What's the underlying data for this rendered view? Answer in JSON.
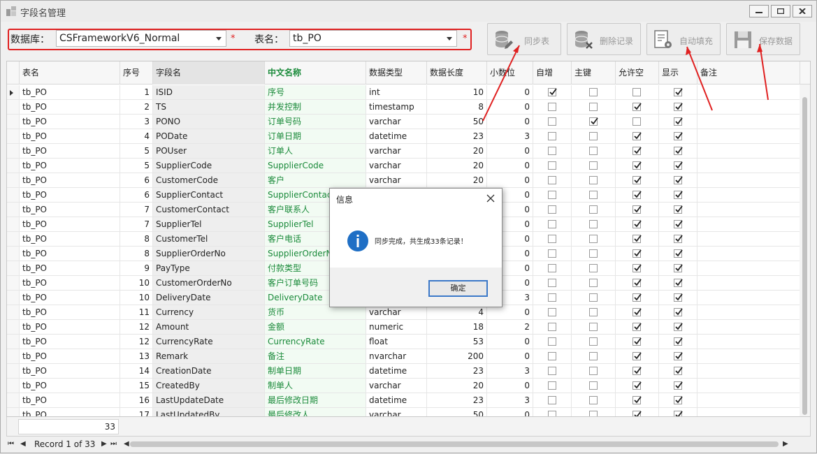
{
  "window": {
    "title": "字段名管理"
  },
  "toolbar": {
    "db_label": "数据库：",
    "db_value": "CSFrameworkV6_Normal",
    "table_label": "表名：",
    "table_value": "tb_PO",
    "required_mark": "*",
    "buttons": [
      {
        "label": "同步表",
        "icon": "database-sync-icon"
      },
      {
        "label": "删除记录",
        "icon": "database-delete-icon"
      },
      {
        "label": "自动填充",
        "icon": "document-gear-icon"
      },
      {
        "label": "保存数据",
        "icon": "floppy-disk-icon"
      }
    ]
  },
  "grid": {
    "columns": [
      "表名",
      "序号",
      "字段名",
      "中文名称",
      "数据类型",
      "数据长度",
      "小数位",
      "自增",
      "主键",
      "允许空",
      "显示",
      "备注"
    ],
    "rows": [
      {
        "table": "tb_PO",
        "seq": "1",
        "field": "ISID",
        "cn": "序号",
        "type": "int",
        "len": "10",
        "dec": "0",
        "auto": true,
        "pk": false,
        "nul": false,
        "show": true
      },
      {
        "table": "tb_PO",
        "seq": "2",
        "field": "TS",
        "cn": "并发控制",
        "type": "timestamp",
        "len": "8",
        "dec": "0",
        "auto": false,
        "pk": false,
        "nul": true,
        "show": true
      },
      {
        "table": "tb_PO",
        "seq": "3",
        "field": "PONO",
        "cn": "订单号码",
        "type": "varchar",
        "len": "50",
        "dec": "0",
        "auto": false,
        "pk": true,
        "nul": false,
        "show": true
      },
      {
        "table": "tb_PO",
        "seq": "4",
        "field": "PODate",
        "cn": "订单日期",
        "type": "datetime",
        "len": "23",
        "dec": "3",
        "auto": false,
        "pk": false,
        "nul": true,
        "show": true
      },
      {
        "table": "tb_PO",
        "seq": "5",
        "field": "POUser",
        "cn": "订单人",
        "type": "varchar",
        "len": "20",
        "dec": "0",
        "auto": false,
        "pk": false,
        "nul": true,
        "show": true
      },
      {
        "table": "tb_PO",
        "seq": "5",
        "field": "SupplierCode",
        "cn": "SupplierCode",
        "type": "varchar",
        "len": "20",
        "dec": "0",
        "auto": false,
        "pk": false,
        "nul": true,
        "show": true
      },
      {
        "table": "tb_PO",
        "seq": "6",
        "field": "CustomerCode",
        "cn": "客户",
        "type": "varchar",
        "len": "20",
        "dec": "0",
        "auto": false,
        "pk": false,
        "nul": true,
        "show": true
      },
      {
        "table": "tb_PO",
        "seq": "6",
        "field": "SupplierContact",
        "cn": "SupplierContact",
        "type": "",
        "len": "",
        "dec": "0",
        "auto": false,
        "pk": false,
        "nul": true,
        "show": true
      },
      {
        "table": "tb_PO",
        "seq": "7",
        "field": "CustomerContact",
        "cn": "客户联系人",
        "type": "",
        "len": "",
        "dec": "0",
        "auto": false,
        "pk": false,
        "nul": true,
        "show": true
      },
      {
        "table": "tb_PO",
        "seq": "7",
        "field": "SupplierTel",
        "cn": "SupplierTel",
        "type": "",
        "len": "",
        "dec": "0",
        "auto": false,
        "pk": false,
        "nul": true,
        "show": true
      },
      {
        "table": "tb_PO",
        "seq": "8",
        "field": "CustomerTel",
        "cn": "客户电话",
        "type": "",
        "len": "",
        "dec": "0",
        "auto": false,
        "pk": false,
        "nul": true,
        "show": true
      },
      {
        "table": "tb_PO",
        "seq": "8",
        "field": "SupplierOrderNo",
        "cn": "SupplierOrderNo",
        "type": "",
        "len": "",
        "dec": "0",
        "auto": false,
        "pk": false,
        "nul": true,
        "show": true
      },
      {
        "table": "tb_PO",
        "seq": "9",
        "field": "PayType",
        "cn": "付款类型",
        "type": "",
        "len": "",
        "dec": "0",
        "auto": false,
        "pk": false,
        "nul": true,
        "show": true
      },
      {
        "table": "tb_PO",
        "seq": "10",
        "field": "CustomerOrderNo",
        "cn": "客户订单号码",
        "type": "",
        "len": "",
        "dec": "0",
        "auto": false,
        "pk": false,
        "nul": true,
        "show": true
      },
      {
        "table": "tb_PO",
        "seq": "10",
        "field": "DeliveryDate",
        "cn": "DeliveryDate",
        "type": "",
        "len": "",
        "dec": "3",
        "auto": false,
        "pk": false,
        "nul": true,
        "show": true
      },
      {
        "table": "tb_PO",
        "seq": "11",
        "field": "Currency",
        "cn": "货币",
        "type": "varchar",
        "len": "4",
        "dec": "0",
        "auto": false,
        "pk": false,
        "nul": true,
        "show": true
      },
      {
        "table": "tb_PO",
        "seq": "12",
        "field": "Amount",
        "cn": "金额",
        "type": "numeric",
        "len": "18",
        "dec": "2",
        "auto": false,
        "pk": false,
        "nul": true,
        "show": true
      },
      {
        "table": "tb_PO",
        "seq": "12",
        "field": "CurrencyRate",
        "cn": "CurrencyRate",
        "type": "float",
        "len": "53",
        "dec": "0",
        "auto": false,
        "pk": false,
        "nul": true,
        "show": true
      },
      {
        "table": "tb_PO",
        "seq": "13",
        "field": "Remark",
        "cn": "备注",
        "type": "nvarchar",
        "len": "200",
        "dec": "0",
        "auto": false,
        "pk": false,
        "nul": true,
        "show": true
      },
      {
        "table": "tb_PO",
        "seq": "14",
        "field": "CreationDate",
        "cn": "制单日期",
        "type": "datetime",
        "len": "23",
        "dec": "3",
        "auto": false,
        "pk": false,
        "nul": true,
        "show": true
      },
      {
        "table": "tb_PO",
        "seq": "15",
        "field": "CreatedBy",
        "cn": "制单人",
        "type": "varchar",
        "len": "20",
        "dec": "0",
        "auto": false,
        "pk": false,
        "nul": true,
        "show": true
      },
      {
        "table": "tb_PO",
        "seq": "16",
        "field": "LastUpdateDate",
        "cn": "最后修改日期",
        "type": "datetime",
        "len": "23",
        "dec": "3",
        "auto": false,
        "pk": false,
        "nul": true,
        "show": true
      },
      {
        "table": "tb_PO",
        "seq": "17",
        "field": "LastUpdatedBy",
        "cn": "最后修改人",
        "type": "varchar",
        "len": "50",
        "dec": "0",
        "auto": false,
        "pk": false,
        "nul": true,
        "show": true
      }
    ]
  },
  "footer": {
    "count": "33",
    "record_text": "Record 1 of 33"
  },
  "dialog": {
    "title": "信息",
    "message": "同步完成，共生成33条记录！",
    "ok_label": "确定"
  },
  "colors": {
    "accent_red": "#e02020",
    "chinese_name_green": "#1a8a3a",
    "ok_border": "#3b78c8",
    "info_blue": "#1f6fc5"
  }
}
